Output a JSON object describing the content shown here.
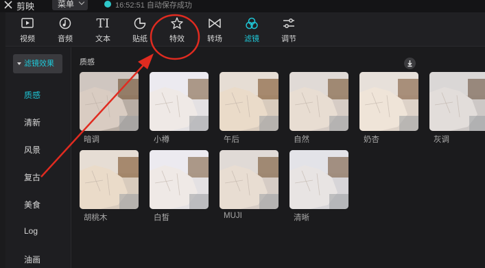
{
  "titlebar": {
    "app_name": "剪映",
    "menu_label": "菜单",
    "save_status": "16:52:51 自动保存成功"
  },
  "toolbar": {
    "tools": [
      {
        "label": "视频",
        "icon": "video-icon"
      },
      {
        "label": "音频",
        "icon": "audio-icon"
      },
      {
        "label": "文本",
        "icon": "text-icon"
      },
      {
        "label": "贴纸",
        "icon": "sticker-icon"
      },
      {
        "label": "特效",
        "icon": "effects-icon"
      },
      {
        "label": "转场",
        "icon": "transition-icon"
      },
      {
        "label": "滤镜",
        "icon": "filter-icon",
        "active": true
      },
      {
        "label": "调节",
        "icon": "adjust-icon"
      }
    ],
    "text_icon_glyph": "TI"
  },
  "sidebar": {
    "header": "滤镜效果",
    "items": [
      "质感",
      "清新",
      "风景",
      "复古",
      "美食",
      "Log",
      "油画"
    ],
    "active_item": "质感"
  },
  "content": {
    "section_title": "质感",
    "filters": [
      {
        "name": "暗调",
        "tone": "dark"
      },
      {
        "name": "小樽",
        "tone": "bright"
      },
      {
        "name": "午后",
        "tone": "warm"
      },
      {
        "name": "自然",
        "tone": "natural"
      },
      {
        "name": "奶杏",
        "tone": "cream",
        "download": true
      },
      {
        "name": "灰调",
        "tone": "gray"
      },
      {
        "name": "胡桃木",
        "tone": "warm"
      },
      {
        "name": "白皙",
        "tone": "bright"
      },
      {
        "name": "MUJI",
        "tone": "natural"
      },
      {
        "name": "清晰",
        "tone": "cool"
      }
    ]
  },
  "colors": {
    "accent": "#1fc6d6",
    "background": "#1b1b1d",
    "annotation": "#e02b20"
  }
}
